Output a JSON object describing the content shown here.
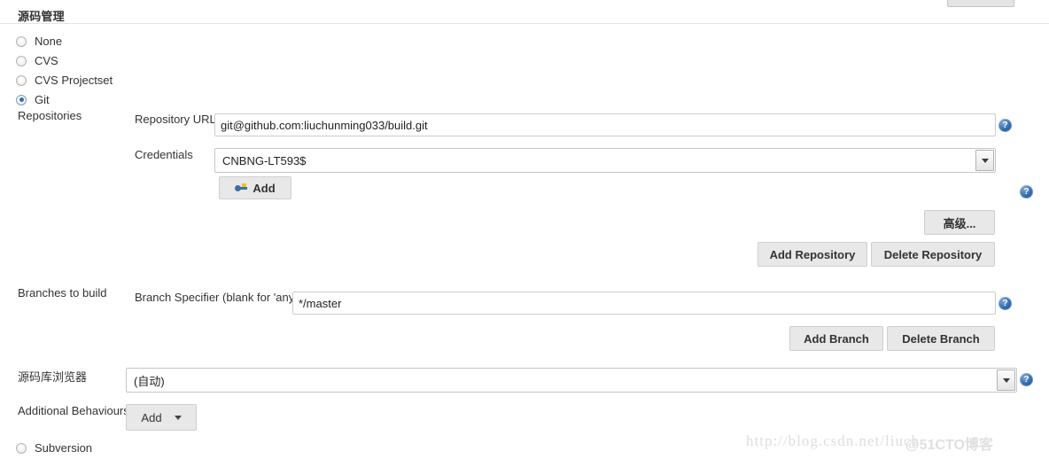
{
  "section": {
    "title": "源码管理"
  },
  "scm_options": [
    {
      "label": "None",
      "checked": false
    },
    {
      "label": "CVS",
      "checked": false
    },
    {
      "label": "CVS Projectset",
      "checked": false
    },
    {
      "label": "Git",
      "checked": true
    },
    {
      "label": "Subversion",
      "checked": false
    }
  ],
  "git": {
    "repositories_label": "Repositories",
    "repository_url_label": "Repository URL",
    "repository_url_value": "git@github.com:liuchunming033/build.git",
    "credentials_label": "Credentials",
    "credentials_value": "CNBNG-LT593$",
    "add_credentials_label": "Add",
    "advanced_label": "高级...",
    "add_repository_label": "Add Repository",
    "delete_repository_label": "Delete Repository",
    "branches_label": "Branches to build",
    "branch_specifier_label": "Branch Specifier (blank for 'any')",
    "branch_specifier_value": "*/master",
    "add_branch_label": "Add Branch",
    "delete_branch_label": "Delete Branch",
    "repo_browser_label": "源码库浏览器",
    "repo_browser_value": "(自动)",
    "additional_behaviours_label": "Additional Behaviours",
    "additional_behaviours_add_label": "Add"
  },
  "help": {
    "glyph": "?"
  },
  "watermark": {
    "url": "http://blog.csdn.net/liuch",
    "site": "@51CTO博客"
  },
  "colors": {
    "accent": "#2f6cab",
    "button_bg": "#e8e8e8",
    "rule": "#e3e3e3"
  }
}
